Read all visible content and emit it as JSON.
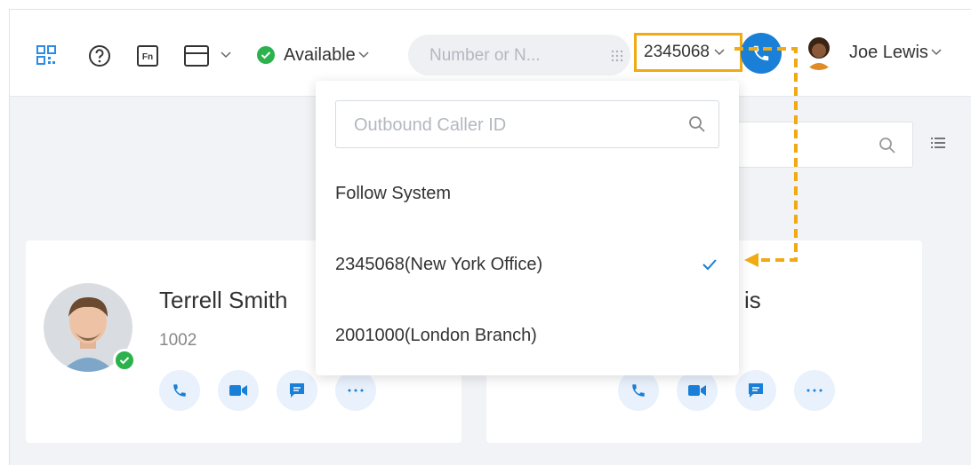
{
  "topbar": {
    "status_label": "Available",
    "dial_placeholder": "Number or N...",
    "caller_id": "2345068",
    "user_name": "Joe Lewis"
  },
  "dropdown": {
    "search_placeholder": "Outbound Caller ID",
    "options": [
      {
        "label": "Follow System"
      },
      {
        "label": "2345068(New York Office)",
        "selected": true
      },
      {
        "label": "2001000(London Branch)"
      }
    ]
  },
  "contacts": [
    {
      "name": "Terrell Smith",
      "ext": "1002",
      "status": "online"
    },
    {
      "name_visible": "is"
    }
  ],
  "colors": {
    "accent": "#1a7fd6",
    "highlight": "#efaa14",
    "online": "#2bb24c"
  },
  "icons": [
    "qr-code-icon",
    "help-icon",
    "fn-key-icon",
    "layout-icon",
    "dialpad-icon",
    "phone-icon",
    "video-icon",
    "message-icon",
    "more-icon",
    "search-icon",
    "list-view-icon"
  ]
}
